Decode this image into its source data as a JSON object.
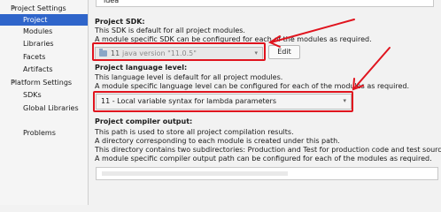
{
  "sidebar": {
    "project_settings": {
      "header": "Project Settings",
      "items": [
        "Project",
        "Modules",
        "Libraries",
        "Facets",
        "Artifacts"
      ]
    },
    "platform_settings": {
      "header": "Platform Settings",
      "items": [
        "SDKs",
        "Global Libraries"
      ]
    },
    "problems": "Problems"
  },
  "project_name": {
    "value": "idea"
  },
  "sdk": {
    "title": "Project SDK:",
    "line1": "This SDK is default for all project modules.",
    "line2": "A module specific SDK can be configured for each of the modules as required.",
    "selected_number": "11",
    "selected_version": "java version \"11.0.5\"",
    "edit_label": "Edit"
  },
  "language_level": {
    "title": "Project language level:",
    "line1": "This language level is default for all project modules.",
    "line2": "A module specific language level can be configured for each of the modules as required.",
    "selected": "11 - Local variable syntax for lambda parameters"
  },
  "compiler_output": {
    "title": "Project compiler output:",
    "lines": [
      "This path is used to store all project compilation results.",
      "A directory corresponding to each module is created under this path.",
      "This directory contains two subdirectories: Production and Test for production code and test sources, respectively.",
      "A module specific compiler output path can be configured for each of the modules as required."
    ]
  },
  "colors": {
    "selection": "#2f65ca",
    "annotation_red": "#e0141e"
  }
}
